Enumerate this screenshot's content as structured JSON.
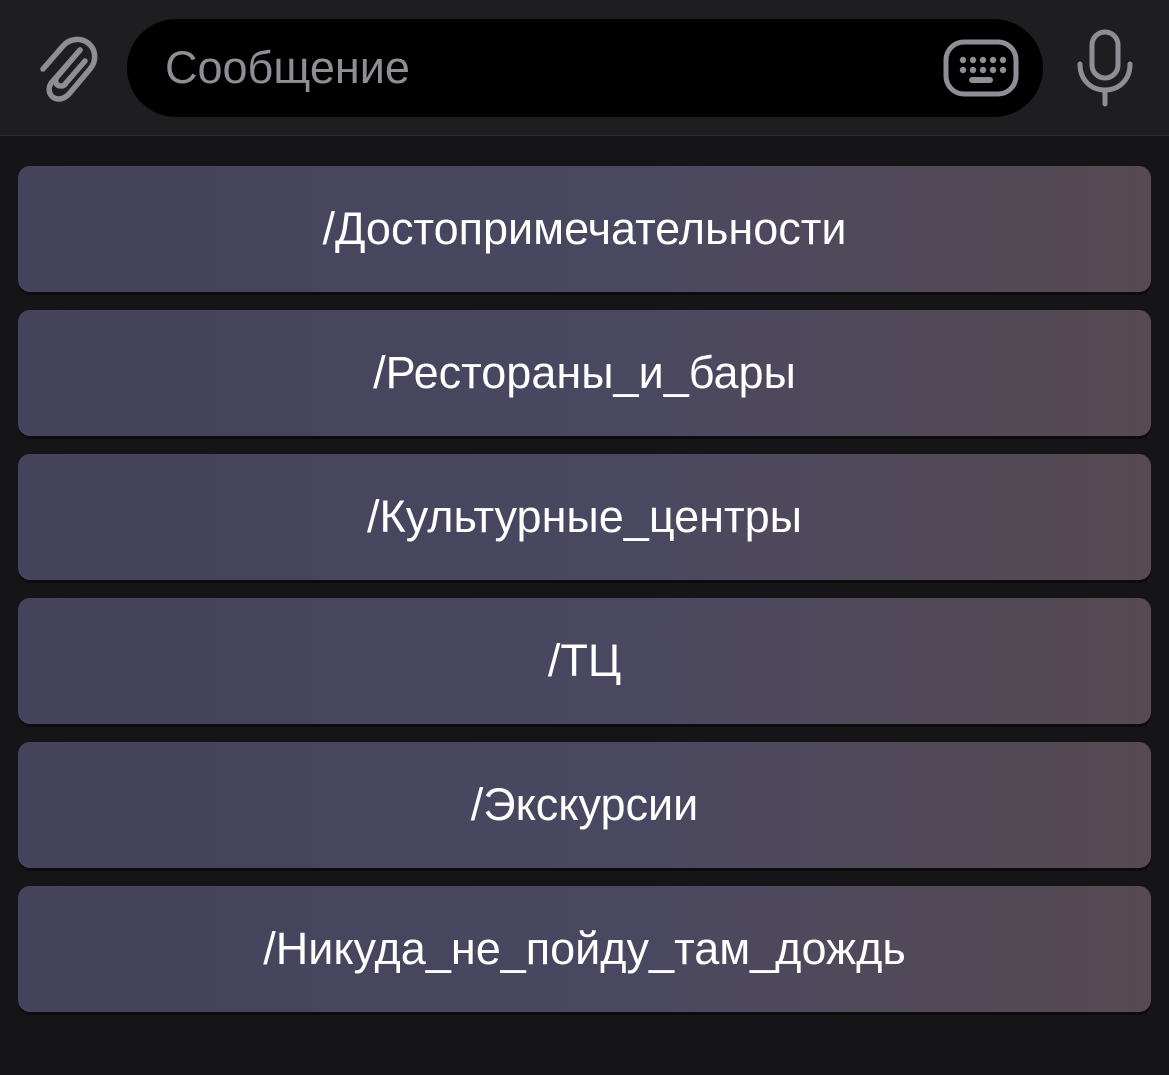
{
  "composer": {
    "placeholder": "Сообщение",
    "value": "",
    "icons": {
      "attach": "paperclip-icon",
      "keyboard": "keyboard-icon",
      "microphone": "microphone-icon"
    }
  },
  "reply_keyboard": {
    "buttons": [
      {
        "label": "/Достопримечательности"
      },
      {
        "label": "/Рестораны_и_бары"
      },
      {
        "label": "/Культурные_центры"
      },
      {
        "label": "/ТЦ"
      },
      {
        "label": "/Экскурсии"
      },
      {
        "label": "/Никуда_не_пойду_там_дождь"
      }
    ]
  },
  "colors": {
    "background": "#151416",
    "input_bar": "#1e1d20",
    "input_field": "#000000",
    "button": "#48465e",
    "icon": "#8f8e94",
    "text": "#ffffff"
  }
}
